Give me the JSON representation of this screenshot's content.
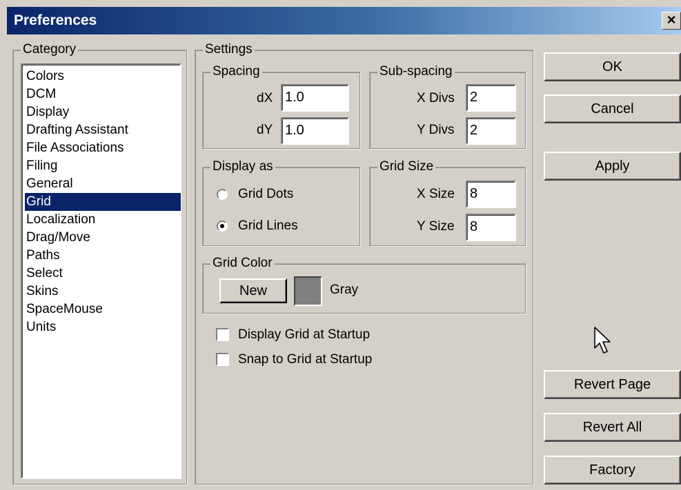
{
  "window": {
    "title": "Preferences",
    "close_glyph": "×",
    "close_icon": "close-icon"
  },
  "category": {
    "legend": "Category",
    "items": [
      "Colors",
      "DCM",
      "Display",
      "Drafting Assistant",
      "File Associations",
      "Filing",
      "General",
      "Grid",
      "Localization",
      "Drag/Move",
      "Paths",
      "Select",
      "Skins",
      "SpaceMouse",
      "Units"
    ],
    "selected": "Grid"
  },
  "settings": {
    "legend": "Settings",
    "spacing": {
      "legend": "Spacing",
      "dx_label": "dX",
      "dx_value": "1.0",
      "dy_label": "dY",
      "dy_value": "1.0"
    },
    "subspacing": {
      "legend": "Sub-spacing",
      "xdivs_label": "X Divs",
      "xdivs_value": "2",
      "ydivs_label": "Y Divs",
      "ydivs_value": "2"
    },
    "display_as": {
      "legend": "Display as",
      "options": [
        "Grid Dots",
        "Grid Lines"
      ],
      "selected": "Grid Lines"
    },
    "grid_size": {
      "legend": "Grid Size",
      "xsize_label": "X Size",
      "xsize_value": "8",
      "ysize_label": "Y Size",
      "ysize_value": "8"
    },
    "grid_color": {
      "legend": "Grid Color",
      "new_label": "New",
      "color_name": "Gray",
      "color_hex": "#808080"
    },
    "checkboxes": [
      {
        "label": "Display Grid at Startup",
        "checked": false
      },
      {
        "label": "Snap to Grid at Startup",
        "checked": false
      }
    ]
  },
  "buttons": {
    "ok": "OK",
    "cancel": "Cancel",
    "apply": "Apply",
    "revert_page": "Revert Page",
    "revert_all": "Revert All",
    "factory": "Factory"
  },
  "colors": {
    "face": "#d4d0c8",
    "selection": "#0a246a",
    "title_start": "#0a246a",
    "title_end": "#a6caf0"
  },
  "cursor_icon": "arrow-cursor-icon"
}
